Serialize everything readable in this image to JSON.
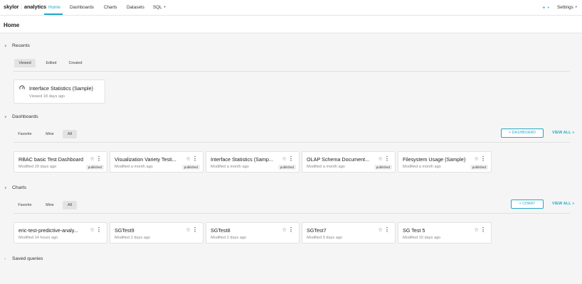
{
  "brand": {
    "name": "skylor",
    "mark": "⋮",
    "suffix": "analytics"
  },
  "nav": {
    "items": [
      "Home",
      "Dashboards",
      "Charts",
      "Datasets",
      "SQL"
    ],
    "plus": "+",
    "settings": "Settings"
  },
  "page": {
    "title": "Home"
  },
  "recents": {
    "title": "Recents",
    "tabs": [
      "Viewed",
      "Edited",
      "Created"
    ],
    "active_tab": "Viewed",
    "card": {
      "title": "Interface Statistics (Sample)",
      "subtitle": "Viewed 18 days ago",
      "icon": "dashboard-gauge-icon"
    }
  },
  "dashboards": {
    "title": "Dashboards",
    "tabs": [
      "Favorite",
      "Mine",
      "All"
    ],
    "active_tab": "All",
    "action": "+ DASHBOARD",
    "view_all": "VIEW ALL »",
    "cards": [
      {
        "title": "RBAC basic Test Dashboard",
        "subtitle": "Modified 29 days ago",
        "badge": "published"
      },
      {
        "title": "Visualization Variety Testi...",
        "subtitle": "Modified a month ago",
        "badge": "published"
      },
      {
        "title": "Interface Statistics (Samp...",
        "subtitle": "Modified a month ago",
        "badge": "published"
      },
      {
        "title": "OLAP Schema Document...",
        "subtitle": "Modified a month ago",
        "badge": "published"
      },
      {
        "title": "Filesystem Usage (Sample)",
        "subtitle": "Modified a month ago",
        "badge": "published"
      }
    ]
  },
  "charts": {
    "title": "Charts",
    "tabs": [
      "Favorite",
      "Mine",
      "All"
    ],
    "active_tab": "All",
    "action": "+ CHART",
    "view_all": "VIEW ALL »",
    "cards": [
      {
        "title": "eric-test-predictive-analy...",
        "subtitle": "Modified 14 hours ago"
      },
      {
        "title": "SGTest9",
        "subtitle": "Modified 2 days ago"
      },
      {
        "title": "SGTest8",
        "subtitle": "Modified 2 days ago"
      },
      {
        "title": "SGTest7",
        "subtitle": "Modified 9 days ago"
      },
      {
        "title": "SG Test 5",
        "subtitle": "Modified 10 days ago"
      }
    ]
  },
  "saved_queries": {
    "title": "Saved queries"
  },
  "icons": {
    "star": "☆",
    "kebab": "⋮",
    "expanded": "∨",
    "collapsed": "›",
    "caret": "▼"
  },
  "colors": {
    "accent": "#1fa8c9",
    "logo_mark": "#f2a93b"
  }
}
